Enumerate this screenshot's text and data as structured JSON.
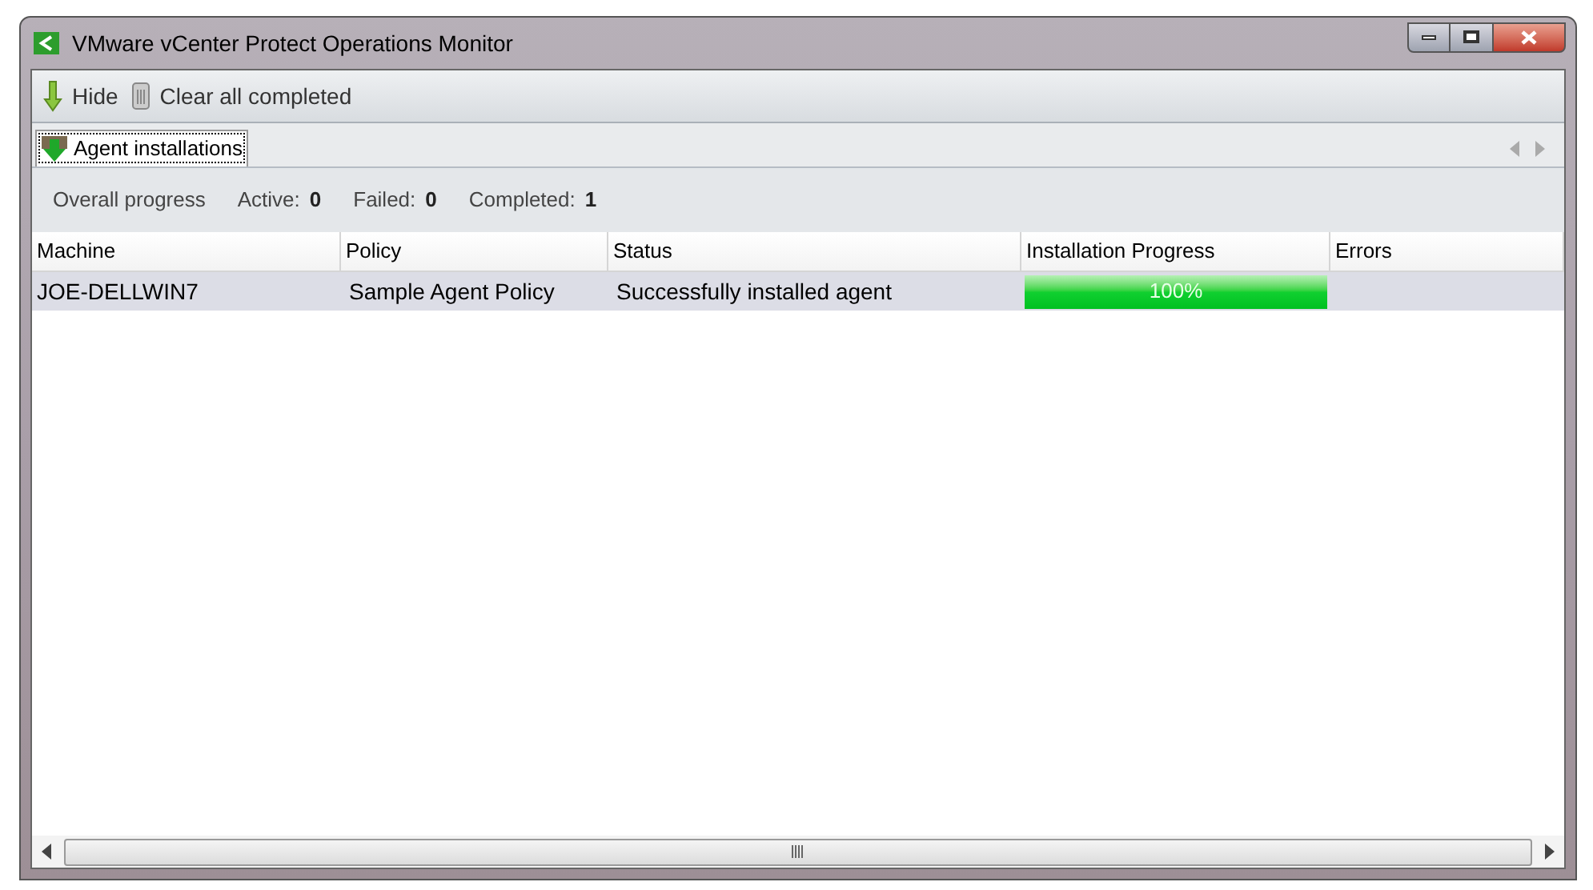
{
  "window": {
    "title": "VMware vCenter Protect Operations Monitor"
  },
  "toolbar": [
    {
      "kind": "hide",
      "label": "Hide"
    },
    {
      "kind": "clear",
      "label": "Clear all completed"
    }
  ],
  "tabs": [
    {
      "label": "Agent installations",
      "selected": true
    }
  ],
  "summary": {
    "label": "Overall progress",
    "stats": [
      {
        "label": "Active:",
        "value": "0"
      },
      {
        "label": "Failed:",
        "value": "0"
      },
      {
        "label": "Completed:",
        "value": "1"
      }
    ]
  },
  "table": {
    "columns": [
      "Machine",
      "Policy",
      "Status",
      "Installation Progress",
      "Errors"
    ],
    "rows": [
      {
        "selected": true,
        "machine": "JOE-DELLWIN7",
        "policy": "Sample Agent Policy",
        "status": "Successfully installed agent",
        "progress": {
          "level": 1,
          "reading": "100%"
        }
      }
    ]
  }
}
